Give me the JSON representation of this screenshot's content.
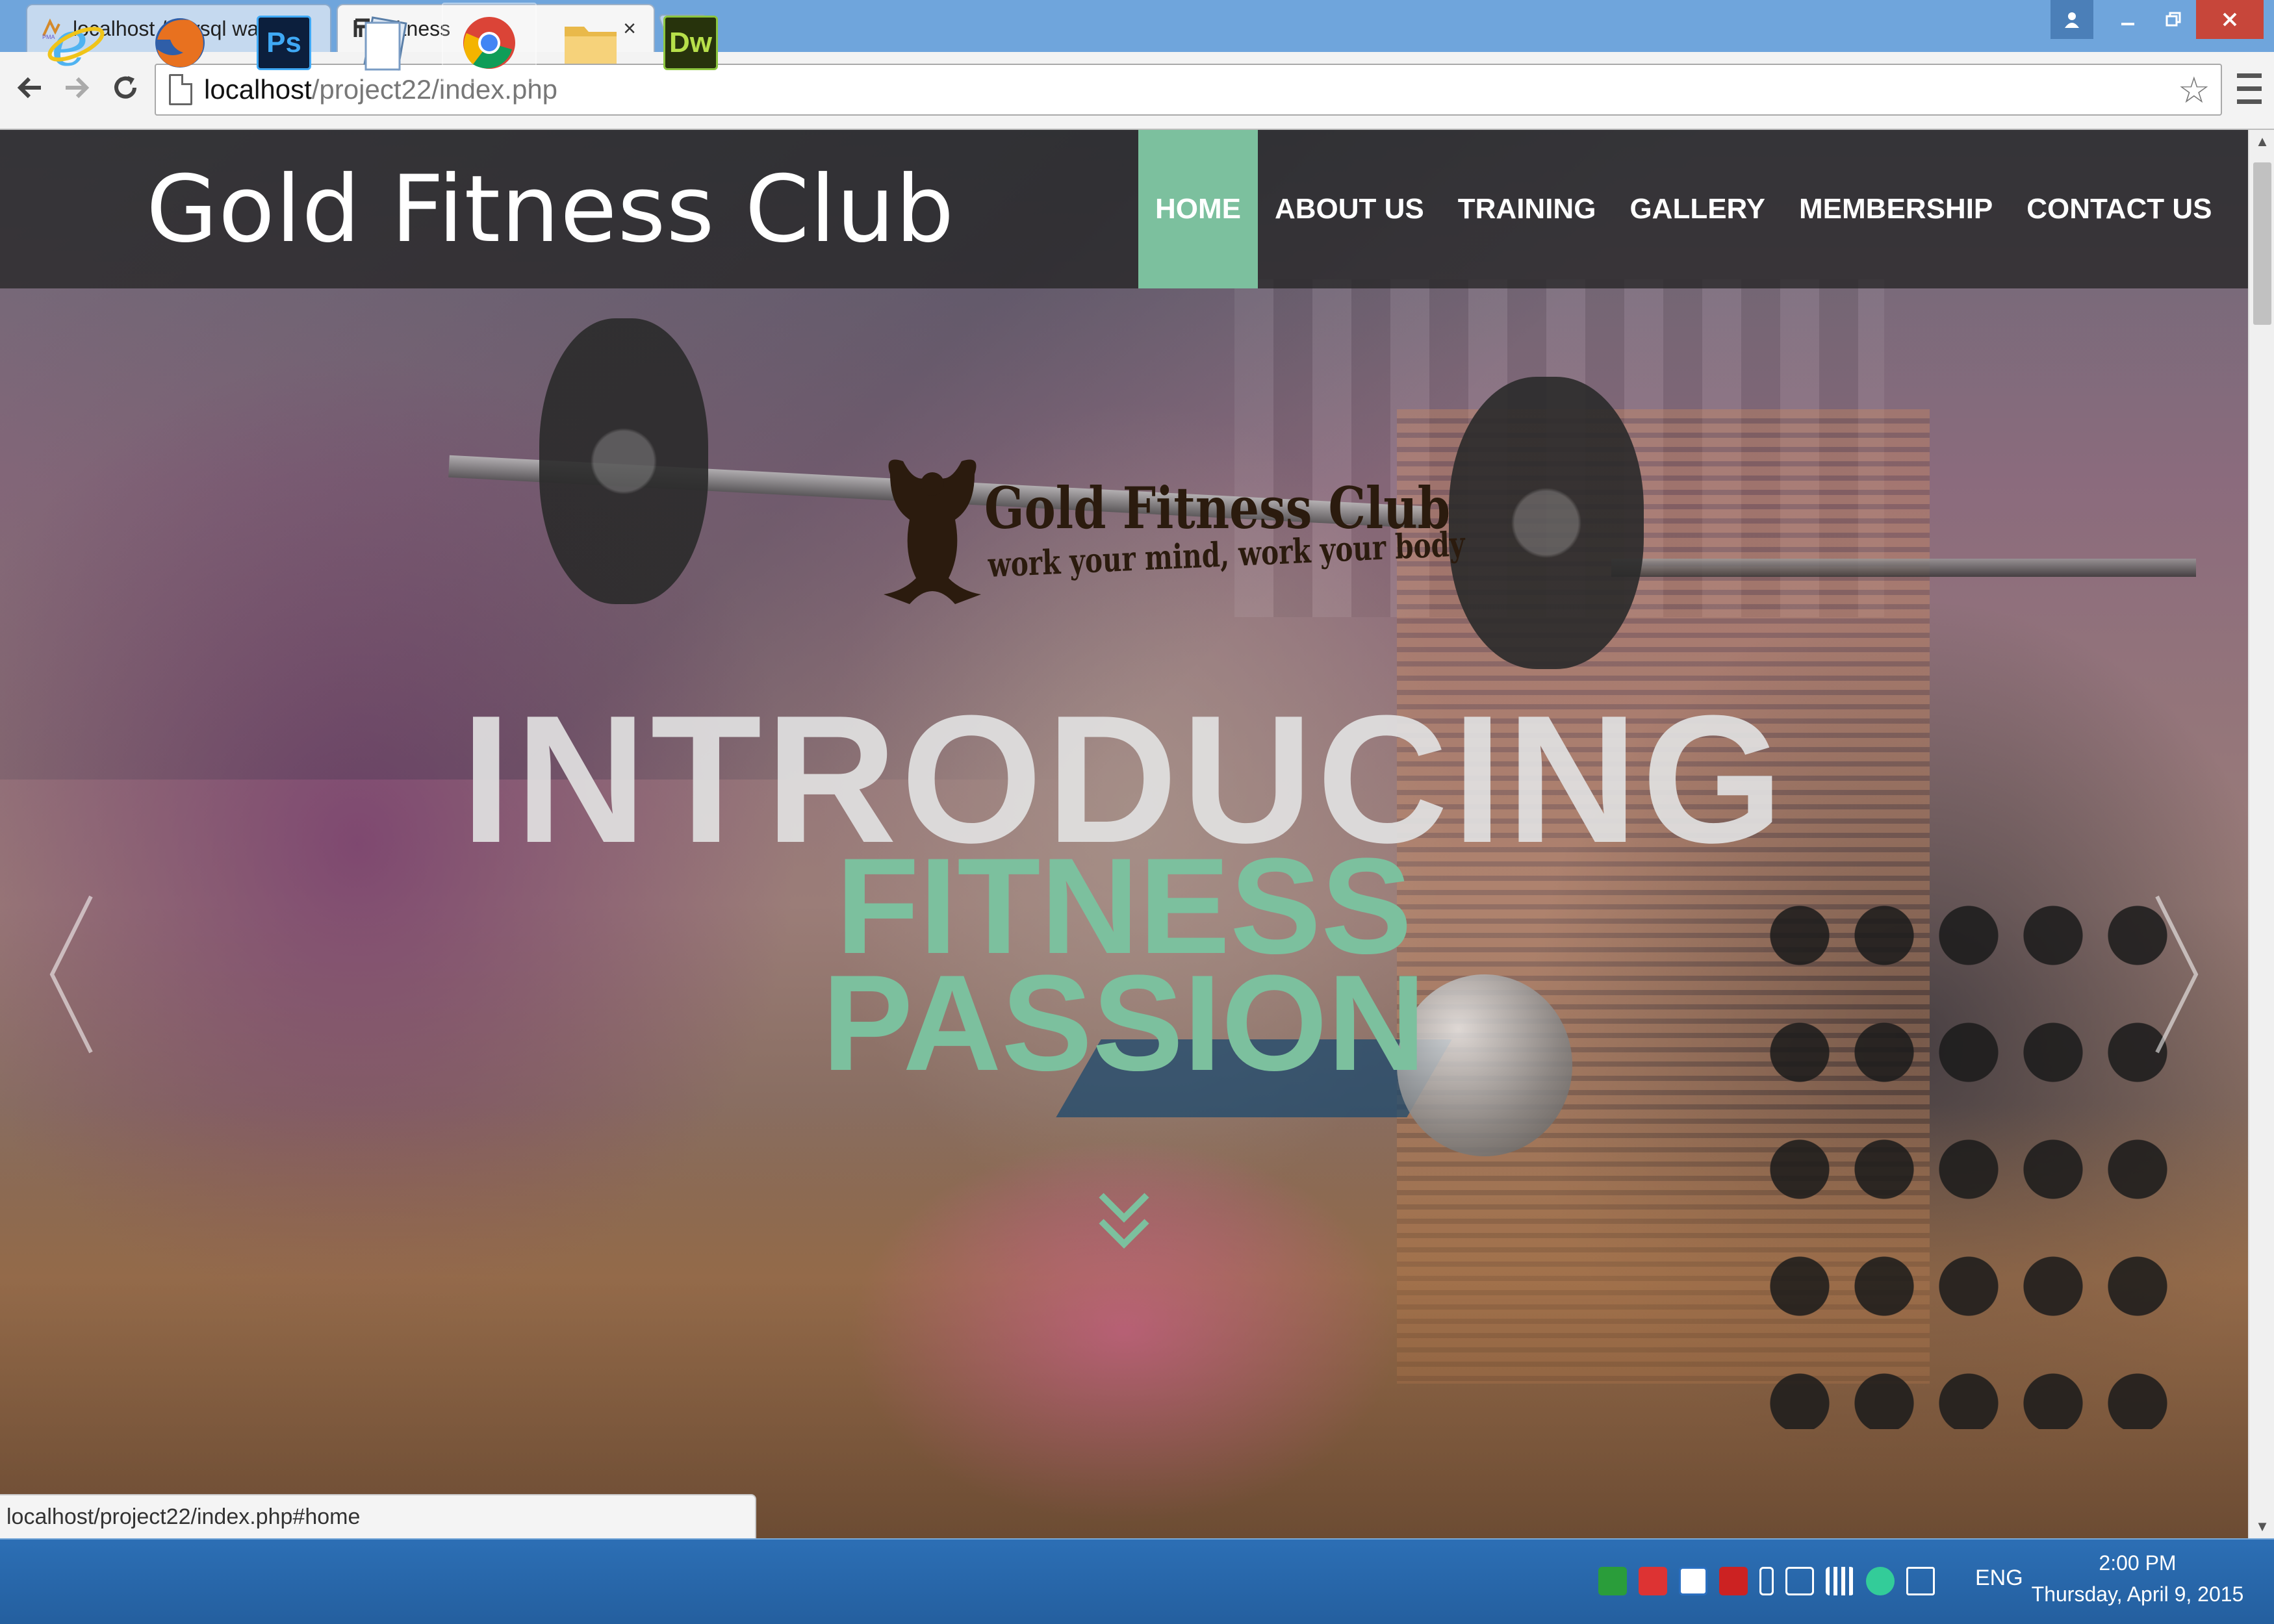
{
  "browser": {
    "tabs": [
      {
        "title": "localhost / mysql wampse",
        "close": "×",
        "icon": "phpmyadmin-icon"
      },
      {
        "title": "Fitness",
        "close": "×",
        "icon": "fitness-favicon-icon"
      }
    ],
    "address": {
      "host": "localhost",
      "path": "/project22/index.php"
    },
    "status_url": "localhost/project22/index.php#home"
  },
  "site": {
    "logo_text": "Gold Fitness Club",
    "nav": [
      {
        "label": "HOME",
        "active": true
      },
      {
        "label": "ABOUT US",
        "active": false
      },
      {
        "label": "TRAINING",
        "active": false
      },
      {
        "label": "GALLERY",
        "active": false
      },
      {
        "label": "MEMBERSHIP",
        "active": false
      },
      {
        "label": "CONTACT US",
        "active": false
      }
    ],
    "brand": {
      "name": "Gold Fitness Club",
      "tagline": "work your mind, work your body"
    },
    "hero": {
      "title": "INTRODUCING",
      "line1": "FITNESS",
      "line2": "PASSION"
    },
    "accent_color": "#7cc09e"
  },
  "taskbar": {
    "apps": [
      {
        "name": "internet-explorer",
        "label": "e"
      },
      {
        "name": "firefox",
        "label": ""
      },
      {
        "name": "photoshop",
        "label": "Ps"
      },
      {
        "name": "notepad",
        "label": ""
      },
      {
        "name": "chrome",
        "label": ""
      },
      {
        "name": "file-explorer",
        "label": ""
      },
      {
        "name": "dreamweaver",
        "label": "Dw"
      }
    ],
    "language": "ENG",
    "time": "2:00 PM",
    "date": "Thursday, April 9, 2015"
  }
}
